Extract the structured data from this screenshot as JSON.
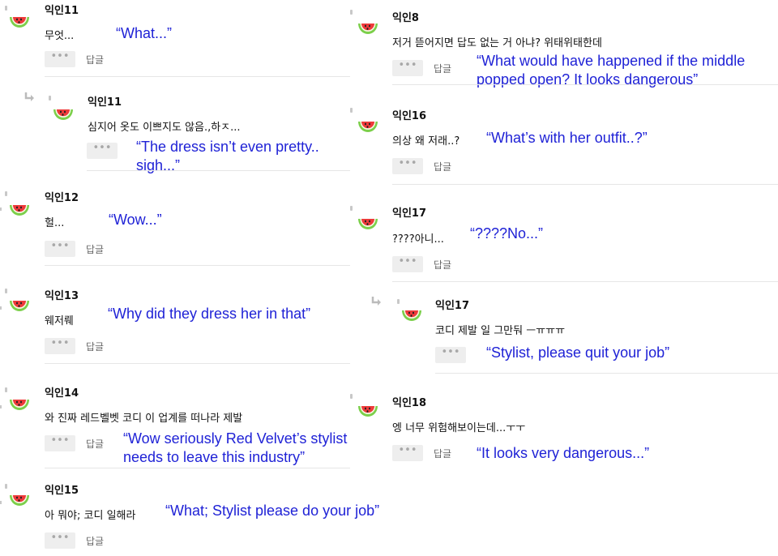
{
  "reply_label": "답글",
  "more_label": "•••",
  "comments": [
    {
      "name": "익인11",
      "text": "무엇...",
      "translation": "“What...”"
    },
    {
      "name": "익인11",
      "text": "심지어 옷도 이쁘지도 않음.,하ㅈ...",
      "translation": "“The dress isn’t even pretty.. sigh...”"
    },
    {
      "name": "익인12",
      "text": "헐...",
      "translation": "“Wow...”"
    },
    {
      "name": "익인13",
      "text": "웨저뤠",
      "translation": "“Why did they dress her in that”"
    },
    {
      "name": "익인14",
      "text": "와 진짜 레드벨벳 코디 이 업계를 떠나라 제발",
      "translation": "“Wow seriously Red Velvet’s stylist needs to leave this industry”"
    },
    {
      "name": "익인15",
      "text": "아 뭐야; 코디 일해라",
      "translation": "“What; Stylist please do your job”"
    },
    {
      "name": "익인8",
      "text": "저거 뜯어지면 답도 없는 거 아냐? 위태위태한데",
      "translation": "“What would have happened if the middle popped open? It looks dangerous”"
    },
    {
      "name": "익인16",
      "text": "의상 왜 저래..?",
      "translation": "“What’s with her outfit..?”"
    },
    {
      "name": "익인17",
      "text": "????아니...",
      "translation": "“????No...”"
    },
    {
      "name": "익인17",
      "text": "코디 제발 일 그만둬 ㅡㅠㅠㅠ",
      "translation": "“Stylist, please quit your job”"
    },
    {
      "name": "익인18",
      "text": "엥 너무 위험해보이는데...ㅜㅜ",
      "translation": "“It looks very dangerous...”"
    }
  ]
}
